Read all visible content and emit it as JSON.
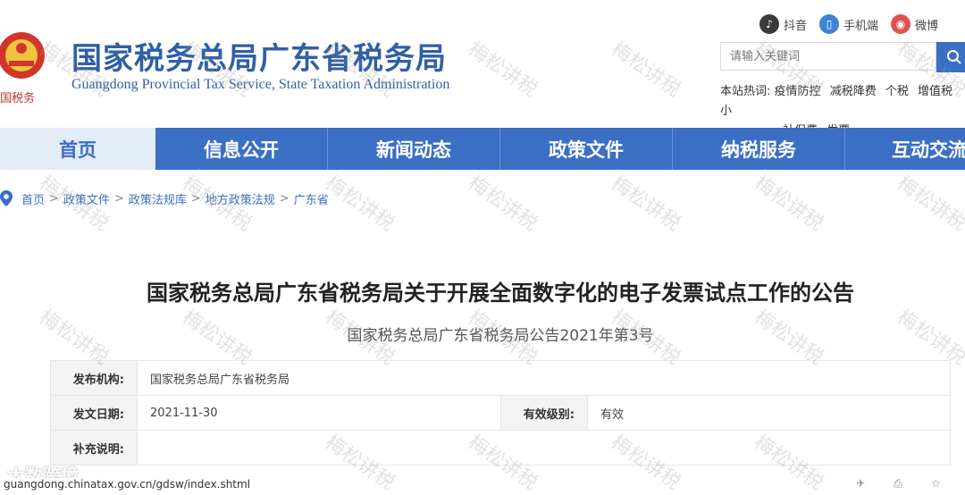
{
  "header": {
    "title_cn": "国家税务总局广东省税务局",
    "title_en": "Guangdong Provincial Tax Service, State Taxation Administration",
    "emblem_caption": "中国税务",
    "top_links": [
      {
        "label": "抖音",
        "icon": "douyin-icon"
      },
      {
        "label": "手机端",
        "icon": "mobile-icon"
      },
      {
        "label": "微博",
        "icon": "weibo-icon"
      }
    ],
    "search_placeholder": "请输入关键词",
    "hot_words_label": "本站热词:",
    "hot_words": [
      "疫情防控",
      "减税降费",
      "个税",
      "增值税",
      "小",
      "社保费",
      "发票"
    ]
  },
  "nav": {
    "items": [
      "首页",
      "信息公开",
      "新闻动态",
      "政策文件",
      "纳税服务",
      "互动交流"
    ],
    "active": "首页"
  },
  "breadcrumb": [
    "首页",
    "政策文件",
    "政策法规库",
    "地方政策法规",
    "广东省"
  ],
  "article": {
    "title": "国家税务总局广东省税务局关于开展全面数字化的电子发票试点工作的公告",
    "doc_number": "国家税务总局广东省税务局公告2021年第3号",
    "meta": {
      "publisher_label": "发布机构:",
      "publisher": "国家税务总局广东省税务局",
      "date_label": "发文日期:",
      "date": "2021-11-30",
      "validity_label": "有效级别:",
      "validity": "有效",
      "note_label": "补充说明:",
      "note": ""
    }
  },
  "status_url": "guangdong.chinatax.gov.cn/gdsw/index.shtml",
  "watermark_text": "梅松讲税",
  "brand_watermark": "大数跨境",
  "colors": {
    "primary": "#3b6fc4",
    "title_blue": "#2f5fa7",
    "active_tab_bg": "#e3ebf6"
  }
}
